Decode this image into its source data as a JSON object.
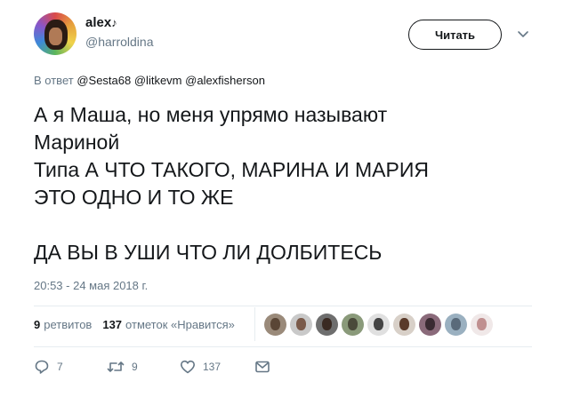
{
  "author": {
    "display_name": "alex",
    "name_suffix": "♪",
    "handle": "@harroldina"
  },
  "follow_button": {
    "label": "Читать"
  },
  "reply_context": {
    "prefix": "В ответ",
    "mentions": [
      "@Sesta68",
      "@litkevm",
      "@alexfisherson"
    ]
  },
  "tweet": {
    "lines": [
      "А я Маша, но меня упрямо называют",
      "Мариной",
      "Типа А ЧТО ТАКОГО, МАРИНА И МАРИЯ",
      "ЭТО ОДНО И ТО ЖЕ",
      "",
      "ДА ВЫ В УШИ ЧТО ЛИ ДОЛБИТЕСЬ"
    ],
    "timestamp": "20:53 - 24 мая 2018 г."
  },
  "stats": {
    "retweets_count": "9",
    "retweets_label": "ретвитов",
    "likes_count": "137",
    "likes_label": "отметок «Нравится»"
  },
  "likers": [
    {
      "bg": "#9a8a7a",
      "fg": "#5a4636"
    },
    {
      "bg": "#c9c9c9",
      "fg": "#7a5a4a"
    },
    {
      "bg": "#6e6e6e",
      "fg": "#3a2a22"
    },
    {
      "bg": "#8a9a7a",
      "fg": "#4a4a3a"
    },
    {
      "bg": "#e0e0e0",
      "fg": "#444444"
    },
    {
      "bg": "#d8d0c8",
      "fg": "#5a3a2a"
    },
    {
      "bg": "#8a6a7a",
      "fg": "#3a2a32"
    },
    {
      "bg": "#9ab0c0",
      "fg": "#5a6a7a"
    },
    {
      "bg": "#f0e8e8",
      "fg": "#c09090"
    }
  ],
  "actions": {
    "reply_count": "7",
    "retweet_count": "9",
    "like_count": "137"
  }
}
